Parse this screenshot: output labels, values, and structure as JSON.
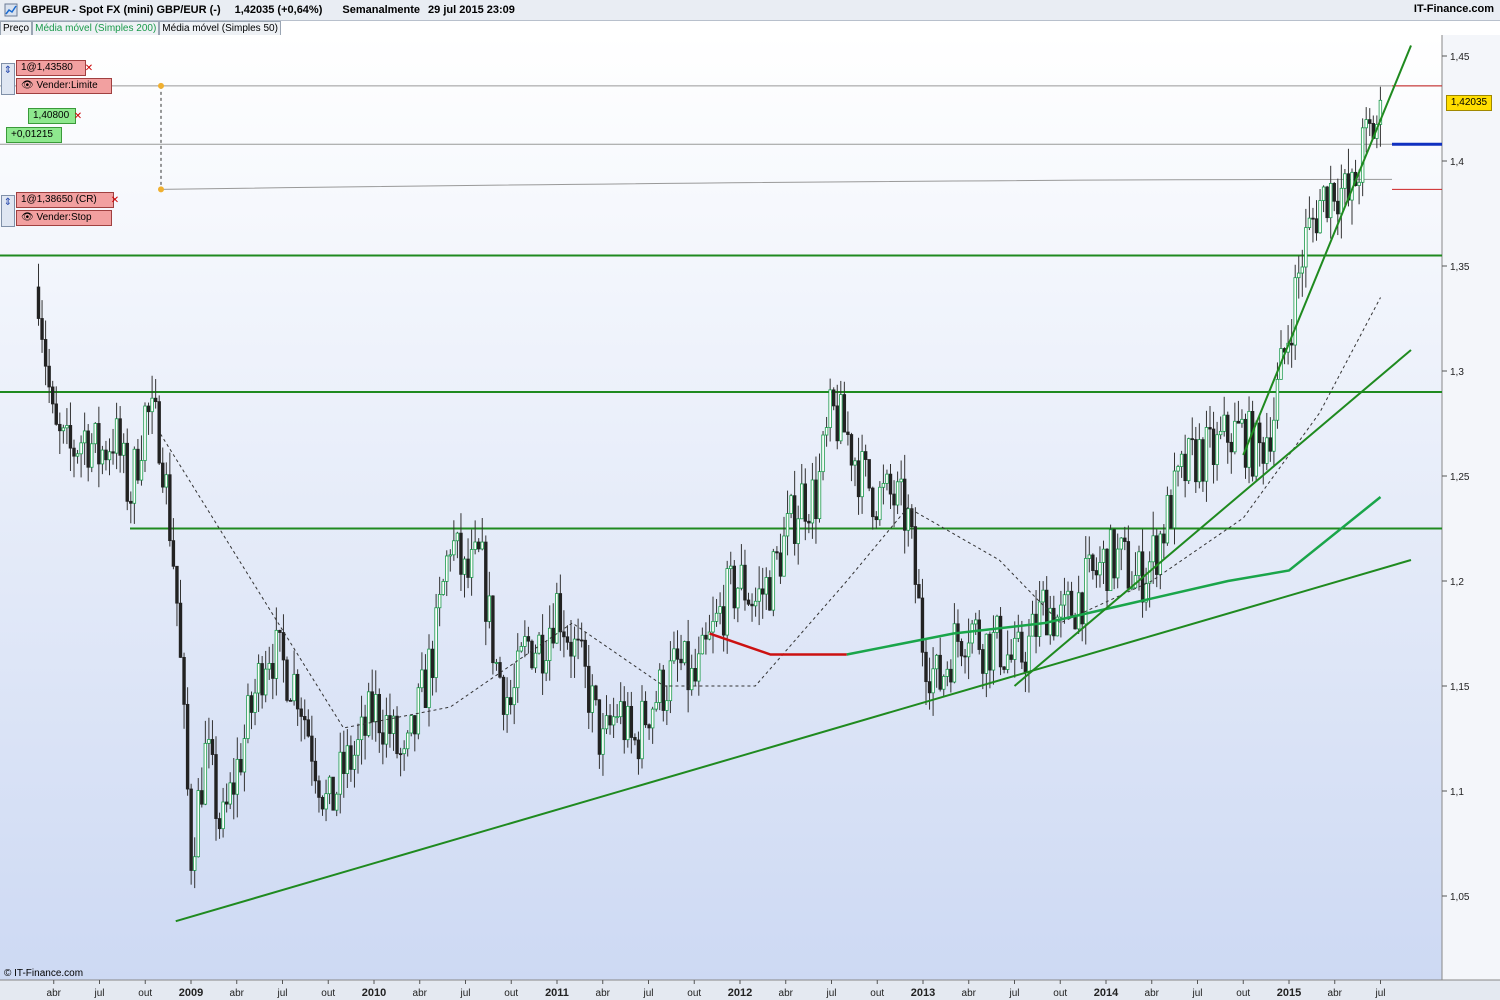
{
  "header": {
    "title": "GBPEUR - Spot FX (mini) GBP/EUR (-)",
    "last_change": "1,42035 (+0,64%)",
    "period": "Semanalmente",
    "date": "29 jul 2015 23:09",
    "brand": "IT-Finance.com"
  },
  "legend_tabs": [
    "Preço",
    "Média móvel (Simples 200)",
    "Média móvel (Simples 50)"
  ],
  "orders": {
    "limit_price": "1@1,43580",
    "limit_action": "Vender:Limite",
    "target_price": "1,40800",
    "target_diff": "+0,01215",
    "stop_price": "1@1,38650 (CR)",
    "stop_action": "Vender:Stop"
  },
  "current_price_label": "1,42035",
  "copyright": "© IT-Finance.com",
  "colors": {
    "up_candle": "#1a9a4a",
    "down_candle": "#222222",
    "trendline": "#1f8a1f",
    "ma200": "#1aa54a",
    "ma200_below": "#cc1111",
    "ma50": "#333333",
    "price_box": "#ffdd00"
  },
  "chart_data": {
    "type": "candlestick",
    "ylim": [
      1.01,
      1.46
    ],
    "y_ticks": [
      "1,45",
      "1,4",
      "1,35",
      "1,3",
      "1,25",
      "1,2",
      "1,15",
      "1,1",
      "1,05"
    ],
    "y_tick_values": [
      1.45,
      1.4,
      1.35,
      1.3,
      1.25,
      1.2,
      1.15,
      1.1,
      1.05
    ],
    "x_ticks": [
      "abr",
      "jul",
      "out",
      "2009",
      "abr",
      "jul",
      "out",
      "2010",
      "abr",
      "jul",
      "out",
      "2011",
      "abr",
      "jul",
      "out",
      "2012",
      "abr",
      "jul",
      "out",
      "2013",
      "abr",
      "jul",
      "out",
      "2014",
      "abr",
      "jul",
      "out",
      "2015",
      "abr",
      "jul"
    ],
    "close_path_monthly": [
      [
        "2008-03",
        1.34
      ],
      [
        "2008-04",
        1.27
      ],
      [
        "2008-05",
        1.26
      ],
      [
        "2008-06",
        1.27
      ],
      [
        "2008-07",
        1.26
      ],
      [
        "2008-08",
        1.27
      ],
      [
        "2008-09",
        1.24
      ],
      [
        "2008-10",
        1.28
      ],
      [
        "2008-11",
        1.27
      ],
      [
        "2008-12",
        1.2
      ],
      [
        "2009-01",
        1.07
      ],
      [
        "2009-02",
        1.12
      ],
      [
        "2009-03",
        1.08
      ],
      [
        "2009-04",
        1.11
      ],
      [
        "2009-05",
        1.14
      ],
      [
        "2009-06",
        1.17
      ],
      [
        "2009-07",
        1.16
      ],
      [
        "2009-08",
        1.15
      ],
      [
        "2009-09",
        1.12
      ],
      [
        "2009-10",
        1.09
      ],
      [
        "2009-11",
        1.11
      ],
      [
        "2009-12",
        1.12
      ],
      [
        "2010-01",
        1.14
      ],
      [
        "2010-02",
        1.13
      ],
      [
        "2010-03",
        1.11
      ],
      [
        "2010-04",
        1.14
      ],
      [
        "2010-05",
        1.17
      ],
      [
        "2010-06",
        1.22
      ],
      [
        "2010-07",
        1.2
      ],
      [
        "2010-08",
        1.21
      ],
      [
        "2010-09",
        1.16
      ],
      [
        "2010-10",
        1.14
      ],
      [
        "2010-11",
        1.17
      ],
      [
        "2010-12",
        1.17
      ],
      [
        "2011-01",
        1.19
      ],
      [
        "2011-02",
        1.17
      ],
      [
        "2011-03",
        1.15
      ],
      [
        "2011-04",
        1.12
      ],
      [
        "2011-05",
        1.14
      ],
      [
        "2011-06",
        1.12
      ],
      [
        "2011-07",
        1.14
      ],
      [
        "2011-08",
        1.15
      ],
      [
        "2011-09",
        1.16
      ],
      [
        "2011-10",
        1.15
      ],
      [
        "2011-11",
        1.17
      ],
      [
        "2011-12",
        1.19
      ],
      [
        "2012-01",
        1.2
      ],
      [
        "2012-02",
        1.19
      ],
      [
        "2012-03",
        1.2
      ],
      [
        "2012-04",
        1.22
      ],
      [
        "2012-05",
        1.24
      ],
      [
        "2012-06",
        1.24
      ],
      [
        "2012-07",
        1.28
      ],
      [
        "2012-08",
        1.27
      ],
      [
        "2012-09",
        1.25
      ],
      [
        "2012-10",
        1.24
      ],
      [
        "2012-11",
        1.24
      ],
      [
        "2012-12",
        1.23
      ],
      [
        "2013-01",
        1.17
      ],
      [
        "2013-02",
        1.15
      ],
      [
        "2013-03",
        1.17
      ],
      [
        "2013-04",
        1.18
      ],
      [
        "2013-05",
        1.17
      ],
      [
        "2013-06",
        1.17
      ],
      [
        "2013-07",
        1.16
      ],
      [
        "2013-08",
        1.17
      ],
      [
        "2013-09",
        1.19
      ],
      [
        "2013-10",
        1.18
      ],
      [
        "2013-11",
        1.19
      ],
      [
        "2013-12",
        1.2
      ],
      [
        "2014-01",
        1.21
      ],
      [
        "2014-02",
        1.21
      ],
      [
        "2014-03",
        1.2
      ],
      [
        "2014-04",
        1.21
      ],
      [
        "2014-05",
        1.23
      ],
      [
        "2014-06",
        1.25
      ],
      [
        "2014-07",
        1.26
      ],
      [
        "2014-08",
        1.26
      ],
      [
        "2014-09",
        1.27
      ],
      [
        "2014-10",
        1.27
      ],
      [
        "2014-11",
        1.26
      ],
      [
        "2014-12",
        1.28
      ],
      [
        "2015-01",
        1.32
      ],
      [
        "2015-02",
        1.36
      ],
      [
        "2015-03",
        1.38
      ],
      [
        "2015-04",
        1.39
      ],
      [
        "2015-05",
        1.38
      ],
      [
        "2015-06",
        1.41
      ],
      [
        "2015-07",
        1.42
      ]
    ],
    "ma200_path": [
      [
        "2011-11",
        1.175
      ],
      [
        "2012-03",
        1.165
      ],
      [
        "2012-08",
        1.165
      ],
      [
        "2013-03",
        1.175
      ],
      [
        "2013-09",
        1.18
      ],
      [
        "2014-03",
        1.19
      ],
      [
        "2014-09",
        1.2
      ],
      [
        "2015-01",
        1.205
      ],
      [
        "2015-07",
        1.24
      ]
    ],
    "ma50_path": [
      [
        "2008-11",
        1.27
      ],
      [
        "2009-05",
        1.2
      ],
      [
        "2009-11",
        1.13
      ],
      [
        "2010-06",
        1.14
      ],
      [
        "2011-02",
        1.18
      ],
      [
        "2011-08",
        1.15
      ],
      [
        "2012-02",
        1.15
      ],
      [
        "2012-08",
        1.2
      ],
      [
        "2012-12",
        1.235
      ],
      [
        "2013-06",
        1.21
      ],
      [
        "2013-10",
        1.18
      ],
      [
        "2014-04",
        1.2
      ],
      [
        "2014-10",
        1.23
      ],
      [
        "2015-03",
        1.28
      ],
      [
        "2015-07",
        1.335
      ]
    ],
    "horizontal_levels": [
      1.355,
      1.29,
      1.225
    ],
    "order_levels": {
      "limit": 1.4358,
      "target": 1.408,
      "stop": 1.3865
    },
    "trendlines": [
      [
        [
          "2008-12",
          1.038
        ],
        [
          "2015-09",
          1.21
        ]
      ],
      [
        [
          "2013-07",
          1.15
        ],
        [
          "2015-09",
          1.31
        ]
      ],
      [
        [
          "2014-10",
          1.26
        ],
        [
          "2015-09",
          1.455
        ]
      ]
    ],
    "grid": false
  }
}
